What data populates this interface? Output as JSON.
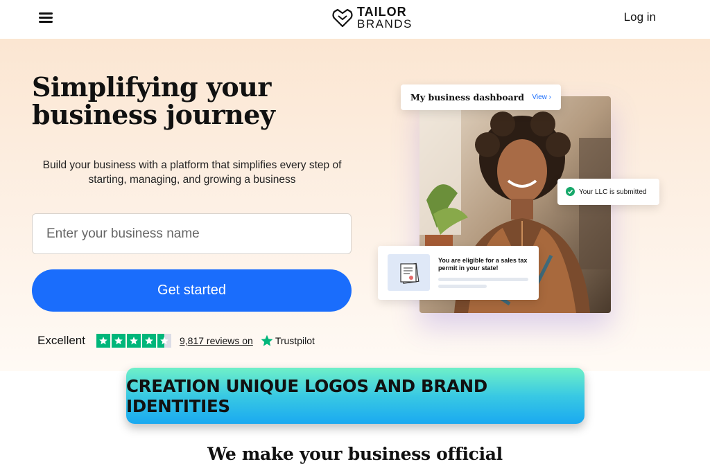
{
  "header": {
    "logo_line1": "TAILOR",
    "logo_line2": "BRANDS",
    "login_label": "Log in"
  },
  "hero": {
    "headline": "Simplifying your business journey",
    "subheadline": "Build your business with a platform that simplifies every step of starting, managing, and growing a business",
    "input_placeholder": "Enter your business name",
    "cta_label": "Get started",
    "trust": {
      "rating_label": "Excellent",
      "stars": 4.5,
      "reviews_text": "9,817 reviews on",
      "brand": "Trustpilot"
    }
  },
  "visual": {
    "dashboard_title": "My business dashboard",
    "dashboard_link": "View ›",
    "llc_status": "Your LLC is submitted",
    "tax_notice": "You are eligible for a sales tax permit in your state!"
  },
  "banner": {
    "text": "CREATION UNIQUE LOGOS AND BRAND IDENTITIES"
  },
  "section": {
    "title": "We make your business official"
  },
  "colors": {
    "primary": "#1a6dfc",
    "trustpilot": "#00b67a",
    "success": "#17a86a",
    "hero_bg": "#fbe6d2"
  }
}
